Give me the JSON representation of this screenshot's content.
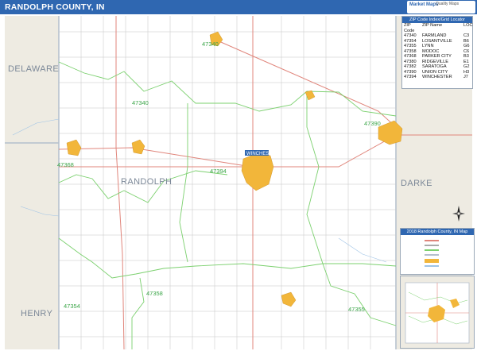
{
  "header": {
    "title": "RANDOLPH COUNTY, IN",
    "brand_logo": "Market Maps",
    "brand_sub": "Quality Maps"
  },
  "map": {
    "county_labels": {
      "delaware": "DELAWARE",
      "randolph": "RANDOLPH",
      "darke": "DARKE",
      "henry": "HENRY"
    },
    "zip_labels": {
      "z47340_north": "47340",
      "z47340_mid": "47340",
      "z47390": "47390",
      "z47368": "47368",
      "z47394": "47394",
      "z47358": "47358",
      "z47354": "47354",
      "z47355": "47355"
    },
    "place_labels": {
      "winchester": "WINCHESTER"
    },
    "colors": {
      "city_fill": "#f2b63a",
      "zip_boundary": "#7bd06e",
      "county_border": "#b4bfcc",
      "outside_county": "#eeebe2",
      "highway": "#e0857b",
      "road": "#a9a9a9",
      "water": "#9ec3e6"
    }
  },
  "zip_table": {
    "title": "ZIP Code Index/Grid Locator",
    "columns": [
      "ZIP Code",
      "ZIP Name",
      "LOC"
    ],
    "rows": [
      [
        "47340",
        "FARMLAND",
        "C3"
      ],
      [
        "47354",
        "LOSANTVILLE",
        "B6"
      ],
      [
        "47355",
        "LYNN",
        "G6"
      ],
      [
        "47358",
        "MODOC",
        "C6"
      ],
      [
        "47368",
        "PARKER CITY",
        "B3"
      ],
      [
        "47380",
        "RIDGEVILLE",
        "E1"
      ],
      [
        "47382",
        "SARATOGA",
        "G2"
      ],
      [
        "47390",
        "UNION CITY",
        "H3"
      ],
      [
        "47394",
        "WINCHESTER",
        "J7"
      ]
    ]
  },
  "legend": {
    "title": "2018 Randolph County, IN Map"
  }
}
